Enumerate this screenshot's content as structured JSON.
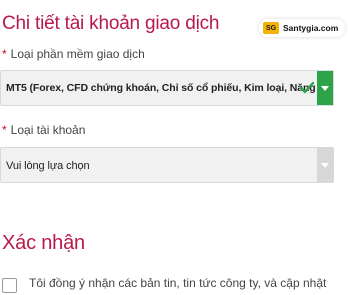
{
  "watermark": {
    "logo_text": "SG",
    "site": "Santygia.com"
  },
  "account_section": {
    "title": "Chi tiết tài khoản giao dịch",
    "platform_field": {
      "required_mark": "*",
      "label": "Loại phần mềm giao dịch",
      "value": "MT5 (Forex, CFD chứng khoán, Chỉ số cổ phiếu, Kim loại, Năng",
      "arrow_color": "#2ea34a"
    },
    "account_type_field": {
      "required_mark": "*",
      "label": "Loại tài khoản",
      "value": "Vui lòng lựa chọn"
    }
  },
  "confirm_section": {
    "title": "Xác nhận",
    "consent_text": "Tôi đồng ý nhận các bản tin, tin tức công ty, và cập nhật"
  },
  "colors": {
    "heading": "#b8194a",
    "required": "#d0021b"
  }
}
